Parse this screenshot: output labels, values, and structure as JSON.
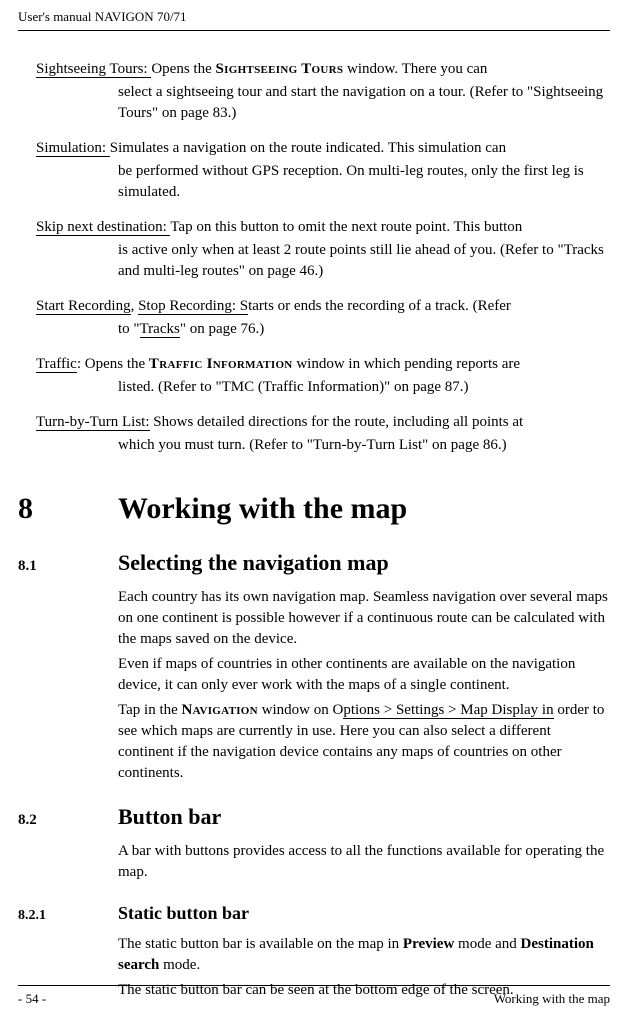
{
  "header": "User's manual NAVIGON 70/71",
  "entries": [
    {
      "term": "Sightseeing Tours: ",
      "after": "Opens the ",
      "sc": "Sightseeing Tours",
      "rest": " window. There you can",
      "body": "select a sightseeing tour and start the navigation on a tour. (Refer to \"Sightseeing Tours\" on page 83.)"
    },
    {
      "term": "Simulation: ",
      "after": "Simulates a navigation on the route indicated. This simulation can",
      "sc": "",
      "rest": "",
      "body": "be performed without GPS reception. On multi-leg routes, only the first leg is simulated."
    },
    {
      "term": "Skip next destination: ",
      "after": "Tap on this button to omit the next route point. This button",
      "sc": "",
      "rest": "",
      "body": "is active only when at least 2 route points still lie ahead of you. (Refer to \"Tracks and multi-leg routes\" on page 46.)"
    },
    {
      "term": "Start Recording",
      "term2": ", ",
      "term3": "Stop Recording: S",
      "after": "tarts or ends the recording of a track. (Refer",
      "sc": "",
      "rest": "",
      "bodyPre": "to \"",
      "bodyU": "Tracks",
      "bodyPost": "\" on page 76.)"
    },
    {
      "term": "Traffic",
      "after": ": Opens the ",
      "sc": "Traffic Information",
      "rest": " window in which pending reports are",
      "body": "listed. (Refer to \"TMC (Traffic Information)\" on page 87.)"
    },
    {
      "term": "Turn-by-Turn List:",
      "after": " Shows detailed directions for the route, including all points at",
      "sc": "",
      "rest": "",
      "body": "which you must turn. (Refer to \"Turn-by-Turn List\" on page 86.)"
    }
  ],
  "chapter": {
    "num": "8",
    "title": "Working with the map"
  },
  "s81": {
    "num": "8.1",
    "title": "Selecting the navigation map",
    "p1": "Each country has its own navigation map. Seamless navigation over several maps on one continent is possible however if a continuous route can be calculated with the maps saved on the device.",
    "p2": "Even if maps of countries in other continents are available on the navigation device, it can only ever work with the maps of a single continent.",
    "p3a": "Tap in the ",
    "p3sc": "Navigation",
    "p3b": " window on O",
    "p3u": "ptions > Settings > Map Display in",
    "p3c": " order to see which maps are currently in use. Here you can also select a different continent if the navigation device contains any maps of countries on other continents."
  },
  "s82": {
    "num": "8.2",
    "title": "Button bar",
    "p1": "A bar with buttons provides access to all the functions available for operating the map."
  },
  "s821": {
    "num": "8.2.1",
    "title": "Static button bar",
    "p1a": "The static button bar is available on the map in ",
    "p1b": "Preview",
    "p1c": " mode and ",
    "p1d": "Destination search",
    "p1e": " mode.",
    "p2": "The static button bar can be seen at the bottom edge of the screen."
  },
  "footer": {
    "page": "- 54 -",
    "label": "Working with the map"
  }
}
